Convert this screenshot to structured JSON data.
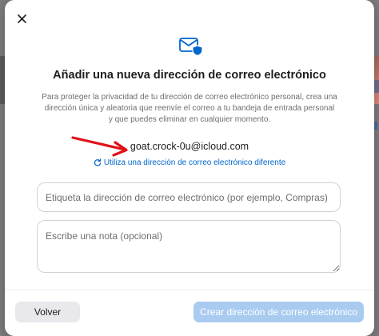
{
  "colors": {
    "accent": "#0066cc",
    "arrow": "#e0101a",
    "primary_disabled": "#a9cbf0",
    "secondary_button": "#e8e8ed"
  },
  "dialog": {
    "close_icon": "close-icon",
    "mail_icon": "envelope-shield-icon",
    "title": "Añadir una nueva dirección de correo electrónico",
    "description": "Para proteger la privacidad de tu dirección de correo electrónico personal, crea una dirección única y aleatoria que reenvíe el correo a tu bandeja de entrada personal y que puedes eliminar en cualquier momento.",
    "generated_email": "goat.crock-0u@icloud.com",
    "alternate_link": "Utiliza una dirección de correo electrónico diferente",
    "label_placeholder": "Etiqueta la dirección de correo electrónico (por ejemplo, Compras)",
    "note_placeholder": "Escribe una nota (opcional)",
    "back_button": "Volver",
    "create_button": "Crear dirección de correo electrónico"
  }
}
